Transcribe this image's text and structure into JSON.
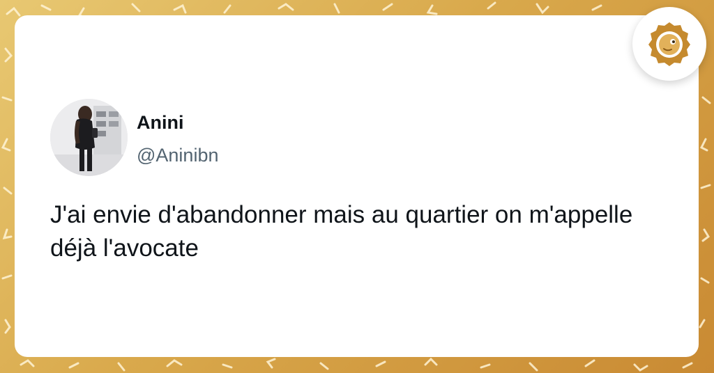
{
  "tweet": {
    "display_name": "Anini",
    "handle": "@Aninibn",
    "text": "J'ai envie d'abandonner mais au quartier on m'appelle déjà l'avocate"
  },
  "icons": {
    "avatar": "profile-photo",
    "brand": "brand-logo"
  },
  "colors": {
    "background": "#d9a94c",
    "card": "#ffffff",
    "text": "#0f1419",
    "handle": "#536471",
    "brand": "#c58a2e"
  }
}
